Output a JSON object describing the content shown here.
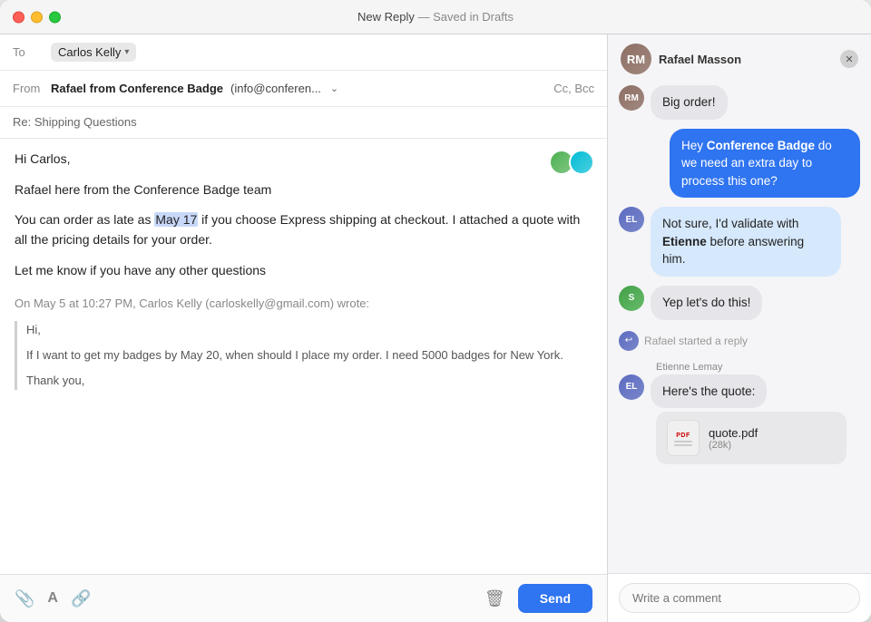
{
  "window": {
    "title": "New Reply",
    "subtitle": "— Saved in Drafts"
  },
  "compose": {
    "to_label": "To",
    "recipient": "Carlos Kelly",
    "from_label": "From",
    "from_name": "Rafael from Conference Badge",
    "from_email": "(info@conferen...",
    "cc_bcc": "Cc, Bcc",
    "subject": "Re: Shipping Questions",
    "body_line1": "Hi Carlos,",
    "body_line2": "Rafael here from the Conference Badge team",
    "body_line3_pre": "You can order as late as ",
    "body_date": "May 17",
    "body_line3_post": " if you choose Express shipping at checkout. I attached a quote with all the pricing details for your order.",
    "body_line4": "Let me know if you have any other questions",
    "quoted_header": "On May 5 at 10:27 PM, Carlos Kelly (carloskelly@gmail.com) wrote:",
    "quoted_1": "Hi,",
    "quoted_2": "If I want to get my badges by May 20, when should I place my order. I need 5000 badges for New York.",
    "quoted_3": "Thank you,",
    "send_button": "Send",
    "toolbar_icons": {
      "attachment": "📎",
      "font": "A",
      "link": "🔗",
      "trash": "🗑"
    }
  },
  "chat": {
    "user_name": "Rafael Masson",
    "messages": [
      {
        "id": 1,
        "sender": "Rafael Masson",
        "avatar_initials": "RM",
        "avatar_color": "olive",
        "text": "Big order!",
        "type": "gray",
        "align": "left"
      },
      {
        "id": 2,
        "sender": "me",
        "text": "Hey Conference Badge do we need an extra day to process this one?",
        "type": "blue",
        "align": "right"
      },
      {
        "id": 3,
        "sender": "Etienne",
        "avatar_initials": "EL",
        "avatar_color": "dark",
        "text_pre": "Not sure, I'd validate with ",
        "bold": "Etienne",
        "text_post": " before answering him.",
        "type": "lightblue",
        "align": "left"
      },
      {
        "id": 4,
        "sender": "Someone",
        "avatar_initials": "S",
        "avatar_color": "green2",
        "text": "Yep let's do this!",
        "type": "gray",
        "align": "left"
      },
      {
        "id": 5,
        "type": "system",
        "text": "Rafael started a reply"
      },
      {
        "id": 6,
        "sender_label": "Etienne Lemay",
        "sender": "Etienne",
        "avatar_initials": "EL",
        "avatar_color": "dark",
        "text": "Here's the quote:",
        "type": "gray",
        "align": "left"
      },
      {
        "id": 7,
        "type": "file",
        "file_name": "quote.pdf",
        "file_size": "(28k)"
      }
    ],
    "comment_placeholder": "Write a comment"
  }
}
